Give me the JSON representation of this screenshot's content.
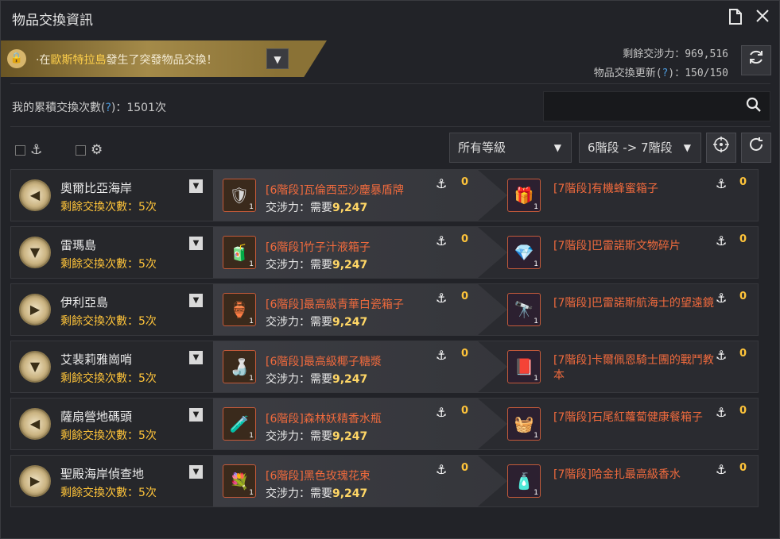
{
  "window": {
    "title": "物品交換資訊"
  },
  "icons": {
    "doc": "document-icon",
    "close": "close-icon"
  },
  "banner": {
    "prefix": "·在",
    "place": "歐斯特拉島",
    "suffix": "發生了突發物品交換！"
  },
  "stats": {
    "energy_label": "剩餘交涉力：",
    "energy_value": "969,516",
    "refresh_label": "物品交換更新(",
    "refresh_q": "?",
    "refresh_suffix": ")：150/150"
  },
  "cumulative": {
    "label": "我的累積交換次數(",
    "q": "?",
    "suffix": ")：1501次"
  },
  "search": {
    "placeholder": ""
  },
  "filters": {
    "grade": "所有等級",
    "tier": "6階段 -> 7階段"
  },
  "rows": [
    {
      "location": "奧爾比亞海岸",
      "remaining": "剩餘交換次數：5次",
      "give_name": "[6階段]瓦倫西亞沙塵暴盾牌",
      "give_cost_label": "交涉力：需要",
      "give_cost": "9,247",
      "give_anchor": "0",
      "give_count": "1",
      "get_name": "[7階段]有機蜂蜜箱子",
      "get_anchor": "0",
      "get_count": "1",
      "give_icon": "🛡",
      "get_icon": "🎁"
    },
    {
      "location": "雷瑪島",
      "remaining": "剩餘交換次數：5次",
      "give_name": "[6階段]竹子汁液箱子",
      "give_cost_label": "交涉力：需要",
      "give_cost": "9,247",
      "give_anchor": "0",
      "give_count": "1",
      "get_name": "[7階段]巴雷諾斯文物碎片",
      "get_anchor": "0",
      "get_count": "1",
      "give_icon": "🧃",
      "get_icon": "💎"
    },
    {
      "location": "伊利亞島",
      "remaining": "剩餘交換次數：5次",
      "give_name": "[6階段]最高級青華白瓷箱子",
      "give_cost_label": "交涉力：需要",
      "give_cost": "9,247",
      "give_anchor": "0",
      "give_count": "1",
      "get_name": "[7階段]巴雷諾斯航海士的望遠鏡",
      "get_anchor": "0",
      "get_count": "1",
      "give_icon": "🏺",
      "get_icon": "🔭"
    },
    {
      "location": "艾裴莉雅崗哨",
      "remaining": "剩餘交換次數：5次",
      "give_name": "[6階段]最高級椰子糖漿",
      "give_cost_label": "交涉力：需要",
      "give_cost": "9,247",
      "give_anchor": "0",
      "give_count": "1",
      "get_name": "[7階段]卡爾佩恩騎士團的戰鬥教本",
      "get_anchor": "0",
      "get_count": "1",
      "give_icon": "🍶",
      "get_icon": "📕"
    },
    {
      "location": "薩扇營地碼頭",
      "remaining": "剩餘交換次數：5次",
      "give_name": "[6階段]森林妖精香水瓶",
      "give_cost_label": "交涉力：需要",
      "give_cost": "9,247",
      "give_anchor": "0",
      "give_count": "1",
      "get_name": "[7階段]石尾紅蘿蔔健康餐箱子",
      "get_anchor": "0",
      "get_count": "1",
      "give_icon": "🧪",
      "get_icon": "🧺"
    },
    {
      "location": "聖殿海岸偵查地",
      "remaining": "剩餘交換次數：5次",
      "give_name": "[6階段]黑色玫瑰花束",
      "give_cost_label": "交涉力：需要",
      "give_cost": "9,247",
      "give_anchor": "0",
      "give_count": "1",
      "get_name": "[7階段]哈金扎最高級香水",
      "get_anchor": "0",
      "get_count": "1",
      "give_icon": "💐",
      "get_icon": "🧴"
    }
  ],
  "colors": {
    "accent": "#ffc43a",
    "item_name": "#ef6a3d",
    "link": "#4d9bde"
  }
}
